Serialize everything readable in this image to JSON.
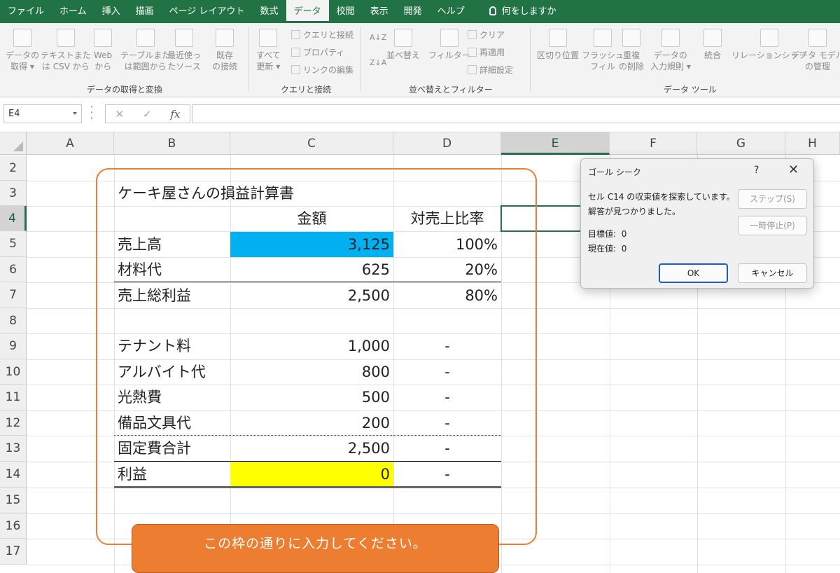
{
  "tabs": [
    {
      "label": "ファイル"
    },
    {
      "label": "ホーム"
    },
    {
      "label": "挿入"
    },
    {
      "label": "描画"
    },
    {
      "label": "ページ レイアウト"
    },
    {
      "label": "数式"
    },
    {
      "label": "データ",
      "active": true
    },
    {
      "label": "校閲"
    },
    {
      "label": "表示"
    },
    {
      "label": "開発"
    },
    {
      "label": "ヘルプ"
    }
  ],
  "tell_me": "何をしますか",
  "ribbon": {
    "get_data": {
      "line1": "データの",
      "line2": "取得 ▾"
    },
    "from_text": {
      "line1": "テキストまた",
      "line2": "は CSV から"
    },
    "from_web": {
      "line1": "Web",
      "line2": "から"
    },
    "from_table": {
      "line1": "テーブルまた",
      "line2": "は範囲から"
    },
    "recent": {
      "line1": "最近使っ",
      "line2": "たソース"
    },
    "existing": {
      "line1": "既存",
      "line2": "の接続"
    },
    "group1": "データの取得と変換",
    "refresh_all": {
      "line1": "すべて",
      "line2": "更新 ▾"
    },
    "queries_connections": "クエリと接続",
    "properties": "プロパティ",
    "edit_links": "リンクの編集",
    "group2": "クエリと接続",
    "sort_az": "A↓Z",
    "sort_za": "Z↓A",
    "sort": "並べ替え",
    "filter": "フィルター",
    "clear": "クリア",
    "reapply": "再適用",
    "advanced": "詳細設定",
    "group3": "並べ替えとフィルター",
    "text_to_columns": "区切り位置",
    "flash_fill": {
      "line1": "フラッシュ",
      "line2": "フィル"
    },
    "remove_dup": {
      "line1": "重複",
      "line2": "の削除"
    },
    "validation": {
      "line1": "データの",
      "line2": "入力規則 ▾"
    },
    "consolidate": "統合",
    "relationships": "リレーションシップ",
    "data_model": {
      "line1": "データ モデル",
      "line2": "の管理"
    },
    "group4": "データ ツール"
  },
  "formula_bar": {
    "name_box": "E4",
    "fx": "fx",
    "cancel": "✕",
    "enter": "✓",
    "formula": ""
  },
  "columns": [
    "A",
    "B",
    "C",
    "D",
    "E",
    "F",
    "G",
    "H"
  ],
  "selected_column": "E",
  "rows": [
    "2",
    "3",
    "4",
    "5",
    "6",
    "7",
    "8",
    "9",
    "10",
    "11",
    "12",
    "13",
    "14",
    "15",
    "16",
    "17"
  ],
  "selected_row": "4",
  "sheet": {
    "title": "ケーキ屋さんの損益計算書",
    "header_amount": "金額",
    "header_ratio": "対売上比率",
    "r5": {
      "label": "売上高",
      "amount": "3,125",
      "ratio": "100%"
    },
    "r6": {
      "label": "材料代",
      "amount": "625",
      "ratio": "20%"
    },
    "r7": {
      "label": "売上総利益",
      "amount": "2,500",
      "ratio": "80%"
    },
    "r9": {
      "label": "テナント料",
      "amount": "1,000",
      "ratio": "-"
    },
    "r10": {
      "label": "アルバイト代",
      "amount": "800",
      "ratio": "-"
    },
    "r11": {
      "label": "光熱費",
      "amount": "500",
      "ratio": "-"
    },
    "r12": {
      "label": "備品文具代",
      "amount": "200",
      "ratio": "-"
    },
    "r13": {
      "label": "固定費合計",
      "amount": "2,500",
      "ratio": "-"
    },
    "r14": {
      "label": "利益",
      "amount": "0",
      "ratio": "-"
    }
  },
  "callout": "この枠の通りに入力してください。",
  "colors": {
    "excel_green": "#217346",
    "amount_fill": "#00b0f0",
    "profit_fill": "#ffff00",
    "callout": "#ed7d31"
  },
  "dialog": {
    "title": "ゴール シーク",
    "help": "?",
    "close": "✕",
    "message1": "セル C14 の収束値を探索しています。",
    "message2": "解答が見つかりました。",
    "target_label": "目標値:",
    "target_value": "0",
    "current_label": "現在値:",
    "current_value": "0",
    "step": "ステップ(S)",
    "pause": "一時停止(P)",
    "ok": "OK",
    "cancel": "キャンセル"
  }
}
